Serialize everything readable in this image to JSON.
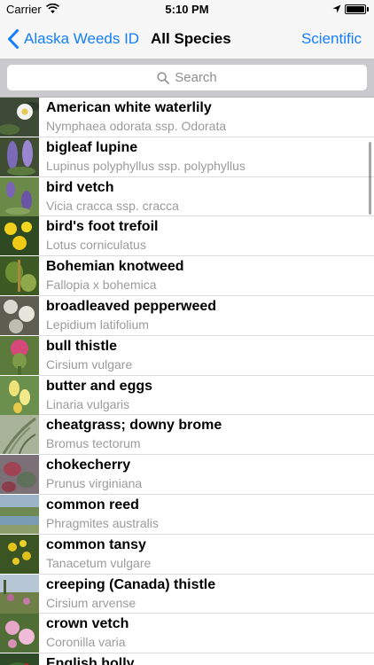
{
  "status_bar": {
    "carrier": "Carrier",
    "time": "5:10 PM"
  },
  "nav": {
    "back_label": "Alaska Weeds ID",
    "title": "All Species",
    "right_label": "Scientific"
  },
  "search": {
    "placeholder": "Search"
  },
  "species": [
    {
      "common": "American white waterlily",
      "scientific": "Nymphaea odorata ssp. Odorata"
    },
    {
      "common": "bigleaf lupine",
      "scientific": "Lupinus polyphyllus ssp. polyphyllus"
    },
    {
      "common": "bird vetch",
      "scientific": "Vicia cracca ssp. cracca"
    },
    {
      "common": "bird's foot trefoil",
      "scientific": "Lotus corniculatus"
    },
    {
      "common": "Bohemian knotweed",
      "scientific": "Fallopia x bohemica"
    },
    {
      "common": "broadleaved pepperweed",
      "scientific": "Lepidium latifolium"
    },
    {
      "common": "bull thistle",
      "scientific": "Cirsium vulgare"
    },
    {
      "common": "butter and eggs",
      "scientific": "Linaria vulgaris"
    },
    {
      "common": "cheatgrass; downy brome",
      "scientific": "Bromus tectorum"
    },
    {
      "common": "chokecherry",
      "scientific": "Prunus virginiana"
    },
    {
      "common": "common reed",
      "scientific": "Phragmites australis"
    },
    {
      "common": "common tansy",
      "scientific": "Tanacetum vulgare"
    },
    {
      "common": "creeping (Canada) thistle",
      "scientific": "Cirsium arvense"
    },
    {
      "common": "crown vetch",
      "scientific": "Coronilla varia"
    },
    {
      "common": "English holly",
      "scientific": ""
    }
  ]
}
